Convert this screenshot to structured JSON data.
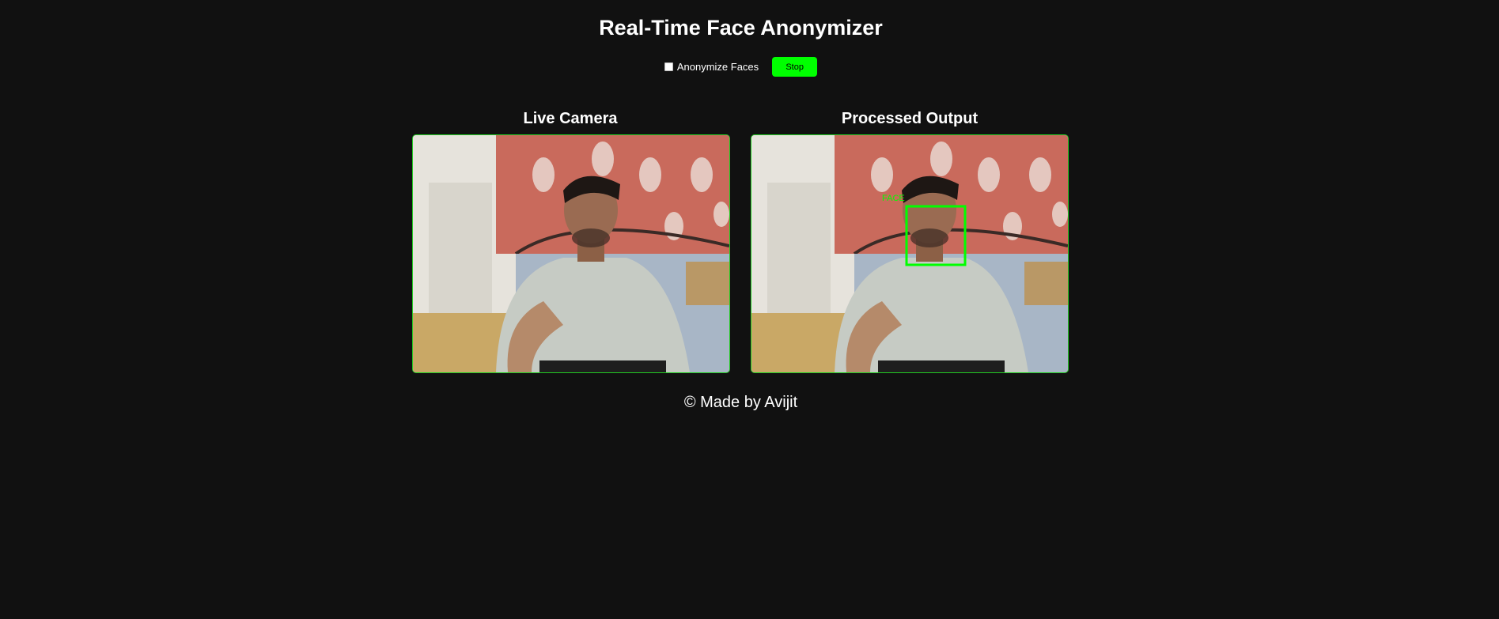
{
  "app": {
    "title": "Real-Time Face Anonymizer"
  },
  "controls": {
    "anonymize_label": "Anonymize Faces",
    "anonymize_checked": false,
    "stop_label": "Stop"
  },
  "panels": [
    {
      "title": "Live Camera"
    },
    {
      "title": "Processed Output",
      "detection_label": "FACE"
    }
  ],
  "footer": {
    "text": "© Made by Avijit"
  },
  "colors": {
    "background": "#111111",
    "accent": "#00ff00",
    "frame_border": "#22cc22"
  }
}
